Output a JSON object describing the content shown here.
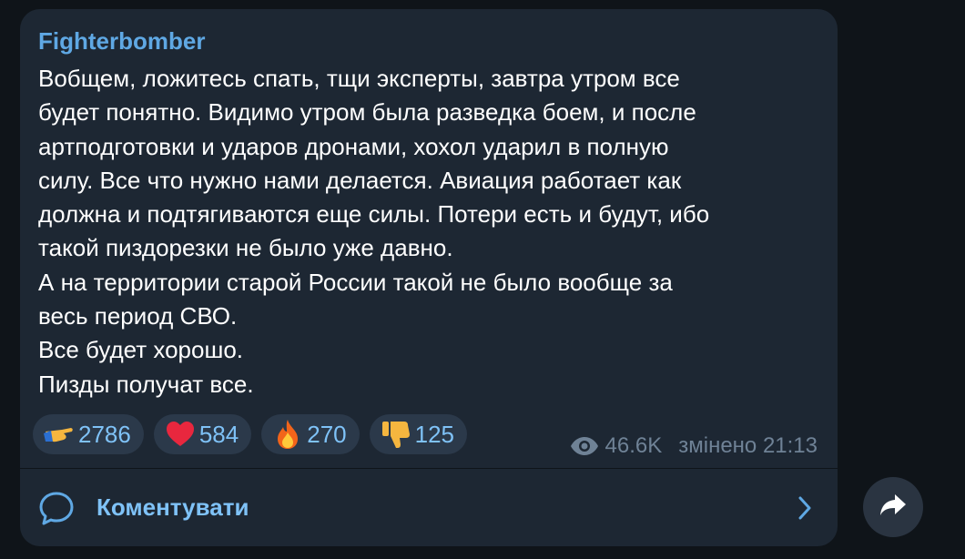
{
  "post": {
    "channel_name": "Fighterbomber",
    "lines": [
      "Вобщем, ложитесь спать, тщи эксперты, завтра утром все",
      "будет понятно. Видимо утром была разведка боем, и после",
      "артподготовки и ударов дронами, хохол ударил в полную",
      "силу. Все что нужно нами делается.  Авиация работает как",
      "должна и подтягиваются еще силы. Потери есть и будут, ибо",
      "такой пиздорезки не было уже давно.",
      "А на территории старой России такой не было вообще за",
      "весь период СВО.",
      "Все будет хорошо.",
      "Пизды получат все."
    ]
  },
  "reactions": [
    {
      "icon": "pointing-hand-icon",
      "count": "2786"
    },
    {
      "icon": "heart-icon",
      "count": "584"
    },
    {
      "icon": "fire-icon",
      "count": "270"
    },
    {
      "icon": "thumbs-down-icon",
      "count": "125"
    }
  ],
  "meta": {
    "views": "46.6K",
    "edited_time": "змінено 21:13"
  },
  "comments": {
    "label": "Коментувати"
  },
  "colors": {
    "background": "#0f1419",
    "bubble": "#1d2733",
    "accent": "#5fa8e4",
    "reaction_bg": "#2b394a",
    "muted": "#6f8296"
  }
}
